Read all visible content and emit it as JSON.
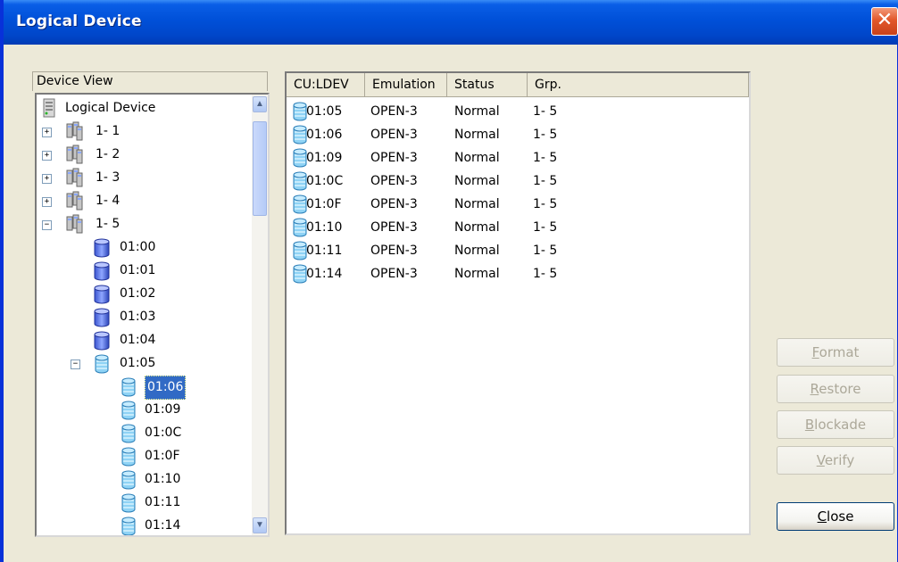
{
  "window": {
    "title": "Logical Device",
    "close_glyph": "✕"
  },
  "tree": {
    "header": "Device View",
    "root_label": "Logical Device",
    "groups": [
      {
        "label": "1- 1",
        "expander": "+"
      },
      {
        "label": "1- 2",
        "expander": "+"
      },
      {
        "label": "1- 3",
        "expander": "+"
      },
      {
        "label": "1- 4",
        "expander": "+"
      },
      {
        "label": "1- 5",
        "expander": "−"
      }
    ],
    "devices": [
      "01:00",
      "01:01",
      "01:02",
      "01:03",
      "01:04"
    ],
    "expanded_device": {
      "label": "01:05",
      "expander": "−"
    },
    "children": [
      "01:06",
      "01:09",
      "01:0C",
      "01:0F",
      "01:10",
      "01:11",
      "01:14"
    ],
    "selected": "01:06",
    "scroll_up": "▲",
    "scroll_down": "▼"
  },
  "list": {
    "columns": [
      "CU:LDEV",
      "Emulation",
      "Status",
      "Grp."
    ],
    "rows": [
      {
        "ldev": "01:05",
        "emulation": "OPEN-3",
        "status": "Normal",
        "grp": "1- 5"
      },
      {
        "ldev": "01:06",
        "emulation": "OPEN-3",
        "status": "Normal",
        "grp": "1- 5"
      },
      {
        "ldev": "01:09",
        "emulation": "OPEN-3",
        "status": "Normal",
        "grp": "1- 5"
      },
      {
        "ldev": "01:0C",
        "emulation": "OPEN-3",
        "status": "Normal",
        "grp": "1- 5"
      },
      {
        "ldev": "01:0F",
        "emulation": "OPEN-3",
        "status": "Normal",
        "grp": "1- 5"
      },
      {
        "ldev": "01:10",
        "emulation": "OPEN-3",
        "status": "Normal",
        "grp": "1- 5"
      },
      {
        "ldev": "01:11",
        "emulation": "OPEN-3",
        "status": "Normal",
        "grp": "1- 5"
      },
      {
        "ldev": "01:14",
        "emulation": "OPEN-3",
        "status": "Normal",
        "grp": "1- 5"
      }
    ]
  },
  "buttons": {
    "format": {
      "first": "F",
      "rest": "ormat",
      "enabled": false
    },
    "restore": {
      "first": "R",
      "rest": "estore",
      "enabled": false
    },
    "blockade": {
      "first": "B",
      "rest": "lockade",
      "enabled": false
    },
    "verify": {
      "first": "V",
      "rest": "erify",
      "enabled": false
    },
    "close": {
      "first": "C",
      "rest": "lose",
      "enabled": true
    }
  },
  "colors": {
    "titlebar": "#0050d8",
    "selection": "#316ac5",
    "dialog_bg": "#ece9d8",
    "close_button": "#e2572a"
  },
  "icons": {
    "root": "server-icon",
    "group": "disk-group-icon",
    "device": "cylinder-disk-icon",
    "child_device": "striped-disk-icon"
  }
}
